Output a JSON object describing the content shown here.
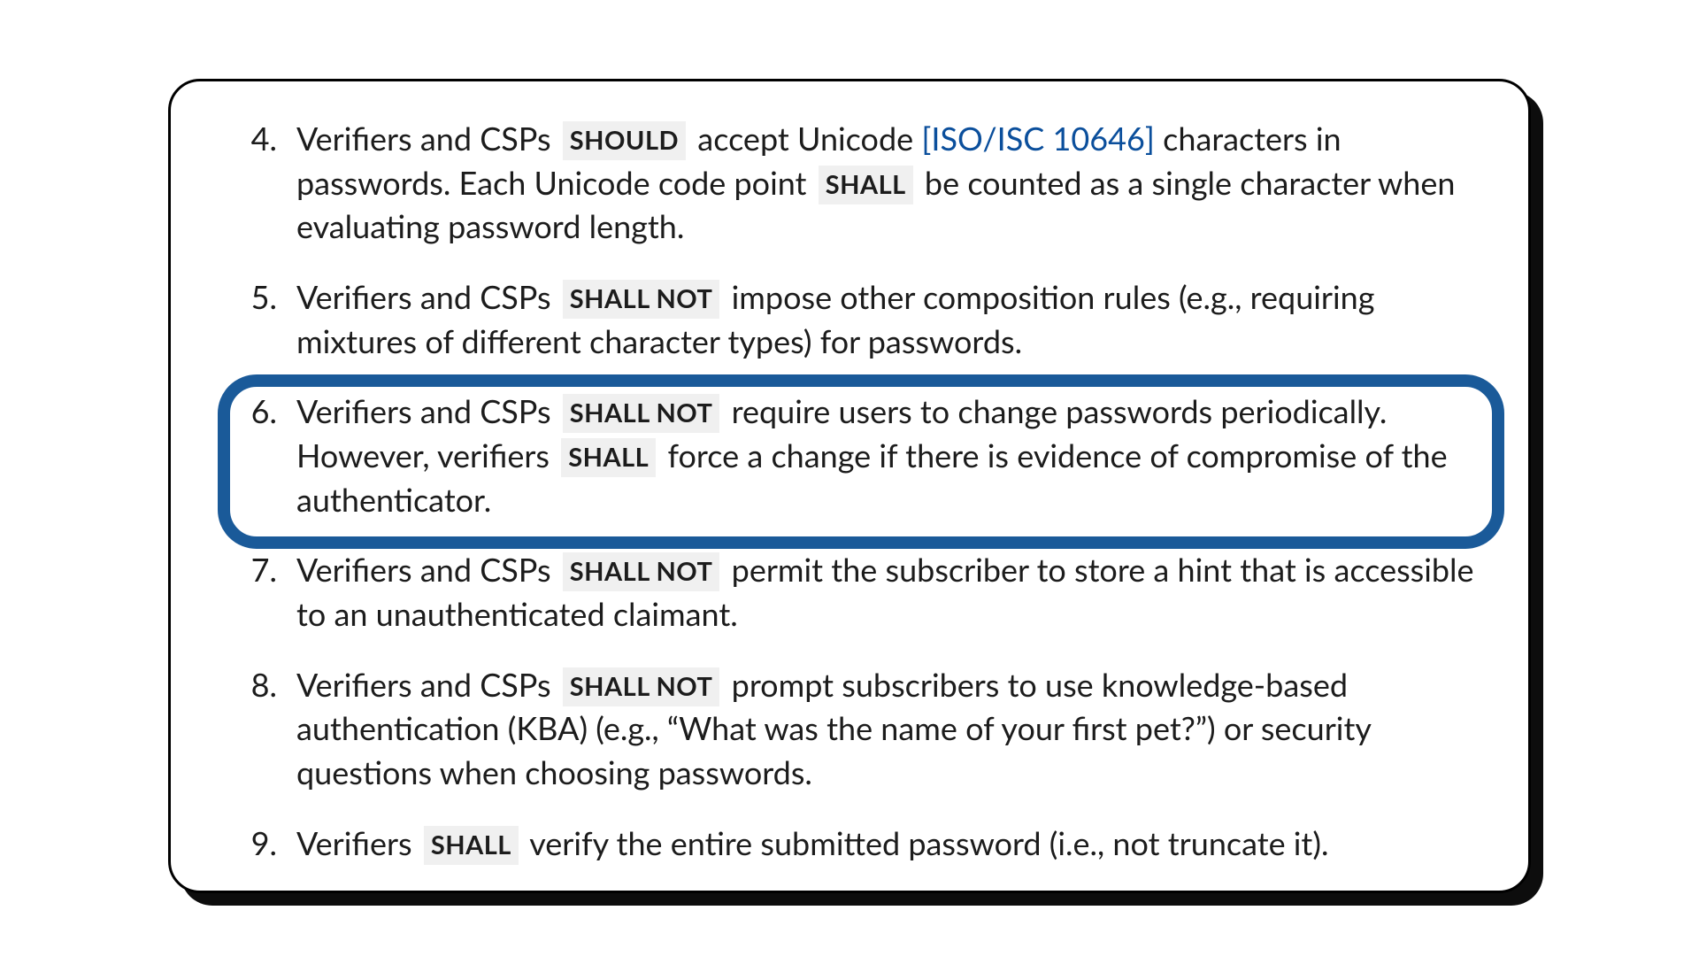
{
  "list_start": 4,
  "highlight_index": 2,
  "items": [
    {
      "segments": [
        {
          "t": "text",
          "v": "Verifiers and CSPs "
        },
        {
          "t": "kw",
          "v": "SHOULD"
        },
        {
          "t": "text",
          "v": " accept Unicode "
        },
        {
          "t": "ref",
          "v": "[ISO/ISC 10646]"
        },
        {
          "t": "text",
          "v": " characters in passwords. Each Unicode code point "
        },
        {
          "t": "kw",
          "v": "SHALL"
        },
        {
          "t": "text",
          "v": " be counted as a single character when evaluating password length."
        }
      ]
    },
    {
      "segments": [
        {
          "t": "text",
          "v": "Verifiers and CSPs "
        },
        {
          "t": "kw",
          "v": "SHALL NOT"
        },
        {
          "t": "text",
          "v": " impose other composition rules (e.g., requiring mixtures of different character types) for passwords."
        }
      ]
    },
    {
      "segments": [
        {
          "t": "text",
          "v": "Verifiers and CSPs "
        },
        {
          "t": "kw",
          "v": "SHALL NOT"
        },
        {
          "t": "text",
          "v": " require users to change passwords periodically. However, verifiers "
        },
        {
          "t": "kw",
          "v": "SHALL"
        },
        {
          "t": "text",
          "v": " force a change if there is evidence of compromise of the authenticator."
        }
      ]
    },
    {
      "segments": [
        {
          "t": "text",
          "v": "Verifiers and CSPs "
        },
        {
          "t": "kw",
          "v": "SHALL NOT"
        },
        {
          "t": "text",
          "v": " permit the subscriber to store a hint that is accessible to an unauthenticated claimant."
        }
      ]
    },
    {
      "segments": [
        {
          "t": "text",
          "v": "Verifiers and CSPs "
        },
        {
          "t": "kw",
          "v": "SHALL NOT"
        },
        {
          "t": "text",
          "v": " prompt subscribers to use knowledge-based authentication (KBA) (e.g., “What was the name of your first pet?”) or security questions when choosing passwords."
        }
      ]
    },
    {
      "segments": [
        {
          "t": "text",
          "v": "Verifiers "
        },
        {
          "t": "kw",
          "v": "SHALL"
        },
        {
          "t": "text",
          "v": " verify the entire submitted password (i.e., not truncate it)."
        }
      ]
    }
  ]
}
